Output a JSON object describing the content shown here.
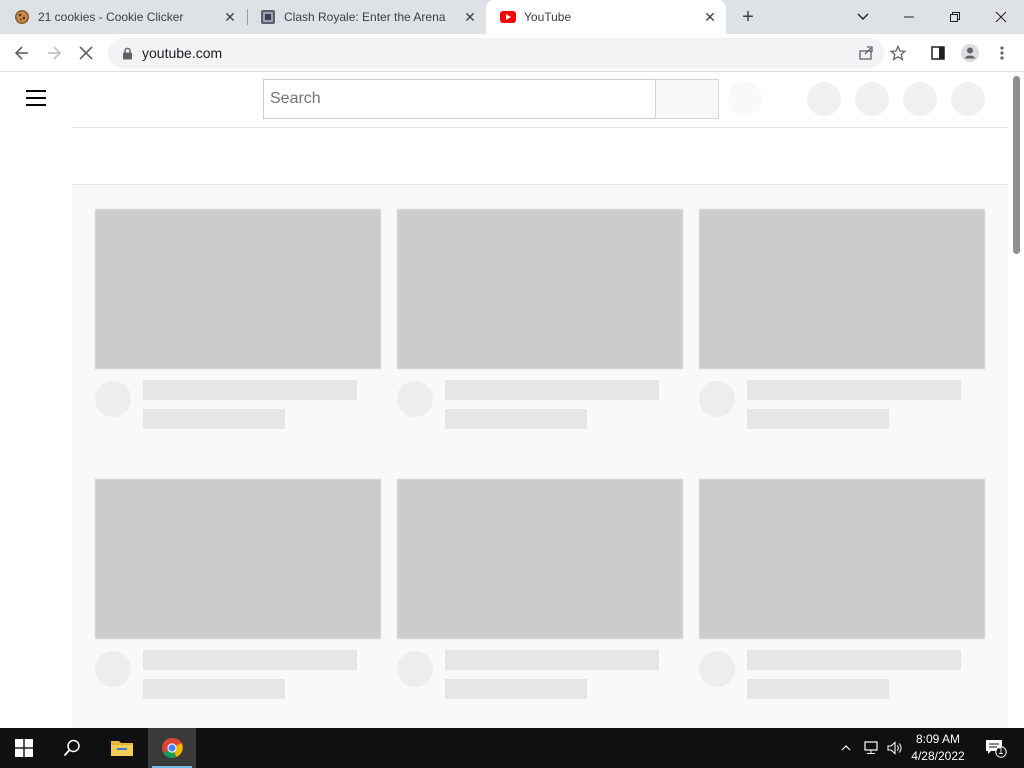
{
  "browser": {
    "tabs": [
      {
        "title": "21 cookies - Cookie Clicker",
        "favicon": "cookie-icon",
        "active": false
      },
      {
        "title": "Clash Royale: Enter the Arena",
        "favicon": "game-icon",
        "active": false
      },
      {
        "title": "YouTube",
        "favicon": "youtube-icon",
        "active": true
      }
    ],
    "url": "youtube.com",
    "accent": "#dee1e6"
  },
  "youtube": {
    "search_placeholder": "Search",
    "brand_color": "#ff0000",
    "loading": true
  },
  "taskbar": {
    "time": "8:09 AM",
    "date": "4/28/2022",
    "notification_count": "1"
  }
}
